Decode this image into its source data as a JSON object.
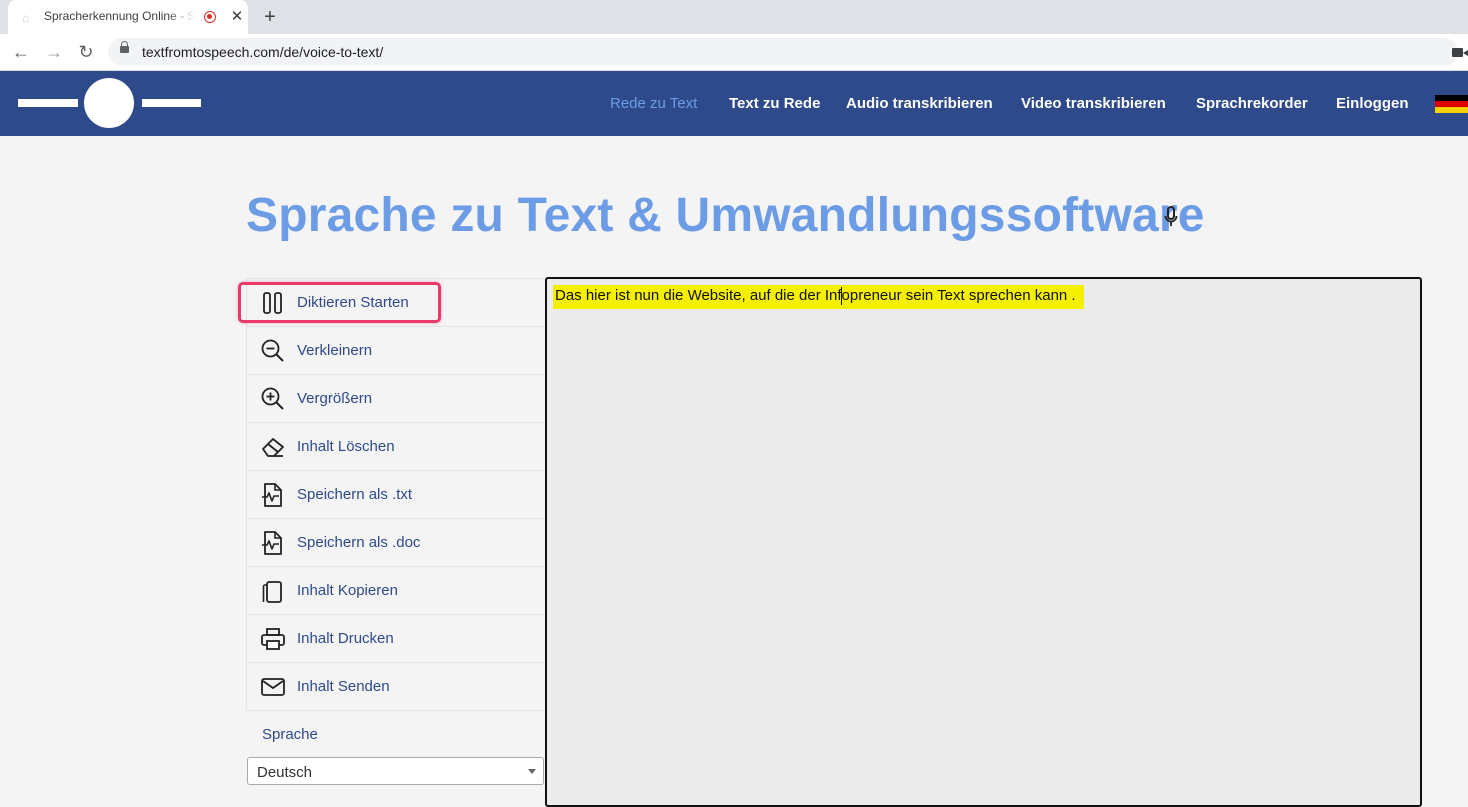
{
  "browser": {
    "tab_title": "Spracherkennung Online - Sp",
    "close_glyph": "✕",
    "new_tab_glyph": "+",
    "back_glyph": "←",
    "forward_glyph": "→",
    "reload_glyph": "↻",
    "url": "textfromtospeech.com/de/voice-to-text/"
  },
  "header": {
    "nav": [
      {
        "label": "Rede zu Text",
        "active": true
      },
      {
        "label": "Text zu Rede"
      },
      {
        "label": "Audio transkribieren"
      },
      {
        "label": "Video transkribieren"
      },
      {
        "label": "Sprachrekorder"
      },
      {
        "label": "Einloggen"
      }
    ],
    "flag_colors": [
      "#000000",
      "#dd0000",
      "#ffce00"
    ],
    "background": "#2e4a8a"
  },
  "main": {
    "title": "Sprache zu Text & Umwandlungssoftware",
    "title_color": "#6c9ce5"
  },
  "sidebar": {
    "items": [
      {
        "label": "Diktieren Starten",
        "icon": "pause-icon"
      },
      {
        "label": "Verkleinern",
        "icon": "zoom-out-icon"
      },
      {
        "label": "Vergrößern",
        "icon": "zoom-in-icon"
      },
      {
        "label": "Inhalt Löschen",
        "icon": "eraser-icon"
      },
      {
        "label": "Speichern als .txt",
        "icon": "file-activity-icon"
      },
      {
        "label": "Speichern als .doc",
        "icon": "file-activity-icon"
      },
      {
        "label": "Inhalt Kopieren",
        "icon": "copy-icon"
      },
      {
        "label": "Inhalt Drucken",
        "icon": "printer-icon"
      },
      {
        "label": "Inhalt Senden",
        "icon": "mail-icon"
      }
    ],
    "language_label": "Sprache",
    "language_value": "Deutsch"
  },
  "editor": {
    "text": "Das hier ist nun die Website, auf die der Infopreneur sein Text sprechen kann .",
    "highlight_color": "#f5f000"
  }
}
